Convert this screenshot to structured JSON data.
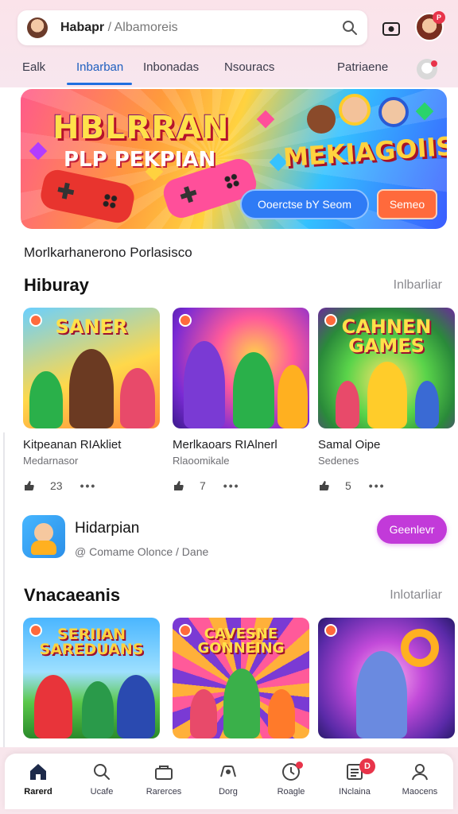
{
  "header": {
    "search": {
      "brand": "Habapr",
      "separator": "/",
      "query": "Albamoreis"
    },
    "profile_badge": "P"
  },
  "tabs": [
    {
      "label": "Ealk"
    },
    {
      "label": "Inbarban"
    },
    {
      "label": "Inbonadas"
    },
    {
      "label": "Nsouracs"
    },
    {
      "label": "Patriaene"
    }
  ],
  "banner": {
    "title": "HBLRRAN",
    "subtitle": "PLP PEKPIAN",
    "heading": "MEKIAGOIIS",
    "primary_button": "Ooerctse bY Seom",
    "secondary_button": "Semeo"
  },
  "caption": "Morlkarhanerono Porlasisco",
  "section1": {
    "title": "Hiburay",
    "link": "Inlbarliar",
    "cards": [
      {
        "thumb_title": "SANER",
        "name": "Kitpeanan RIAkliet",
        "sub": "Medarnasor",
        "count": "23"
      },
      {
        "thumb_title": "",
        "name": "Merlkaoars RIAlnerl",
        "sub": "Rlaoomikale",
        "count": "7"
      },
      {
        "thumb_title": "CAHNEN GAMES",
        "name": "Samal Oipe",
        "sub": "Sedenes",
        "count": "5"
      }
    ]
  },
  "promo": {
    "title": "Hidarpian",
    "sub": "@ Comame Olonce / Dane",
    "button": "Geenlevr"
  },
  "section2": {
    "title": "Vnacaeanis",
    "link": "Inlotarliar",
    "cards": [
      {
        "thumb_title": "SERIIAN SAREDUANS"
      },
      {
        "thumb_title": "CAVESNE GONNEING"
      },
      {
        "thumb_title": ""
      }
    ]
  },
  "bottom_nav": [
    {
      "label": "Rarerd",
      "icon": "home-icon"
    },
    {
      "label": "Ucafe",
      "icon": "search-icon"
    },
    {
      "label": "Rarerces",
      "icon": "store-icon"
    },
    {
      "label": "Dorg",
      "icon": "gamepad-icon"
    },
    {
      "label": "Roagle",
      "icon": "activity-icon"
    },
    {
      "label": "INclaina",
      "icon": "news-icon",
      "badge": "D"
    },
    {
      "label": "Maocens",
      "icon": "person-icon"
    }
  ],
  "colors": {
    "accent": "#1f6fe0",
    "promo_button": "#c23ad9",
    "badge": "#e8344a",
    "header_bg": "#fbe3ea"
  }
}
